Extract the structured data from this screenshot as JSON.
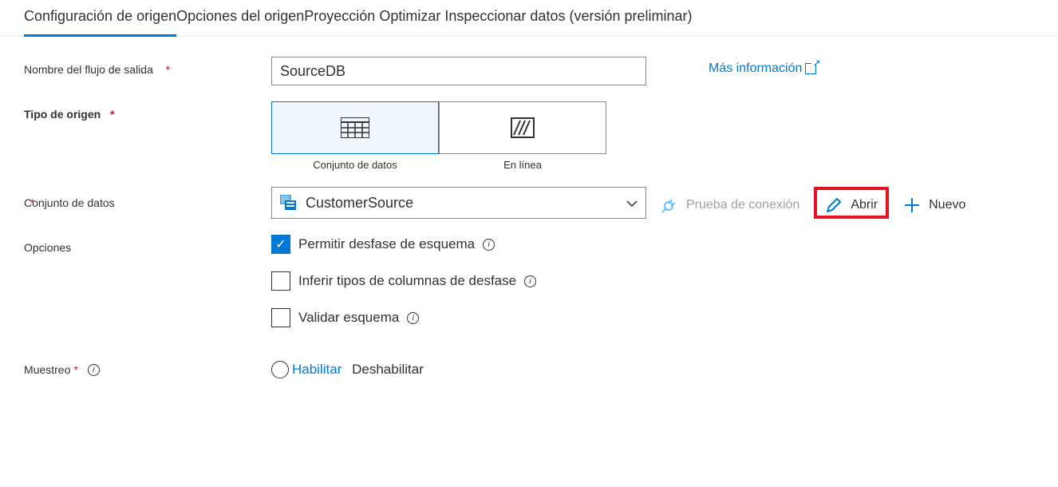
{
  "tabs": {
    "source_settings": "Configuración de origen",
    "source_options": "Opciones del origen",
    "projection": "Proyección",
    "optimize": "Optimizar",
    "inspect": "Inspeccionar",
    "data_preview": "datos (versión preliminar)"
  },
  "labels": {
    "output_stream_name": "Nombre del flujo de salida",
    "source_type": "Tipo de origen",
    "dataset": "Conjunto de datos",
    "options": "Opciones",
    "sampling": "Muestreo",
    "required": "*"
  },
  "fields": {
    "output_stream_value": "SourceDB",
    "more_info": "Más información",
    "source_type_dataset": "Conjunto de datos",
    "source_type_inline": "En línea",
    "dataset_selected": "CustomerSource",
    "test_connection": "Prueba de conexión",
    "open": "Abrir",
    "new": "Nuevo"
  },
  "options": {
    "allow_schema_drift": "Permitir desfase de esquema",
    "infer_drifted_types": "Inferir tipos de columnas de desfase",
    "validate_schema": "Validar esquema"
  },
  "sampling": {
    "enable": "Habilitar",
    "disable": "Deshabilitar"
  }
}
